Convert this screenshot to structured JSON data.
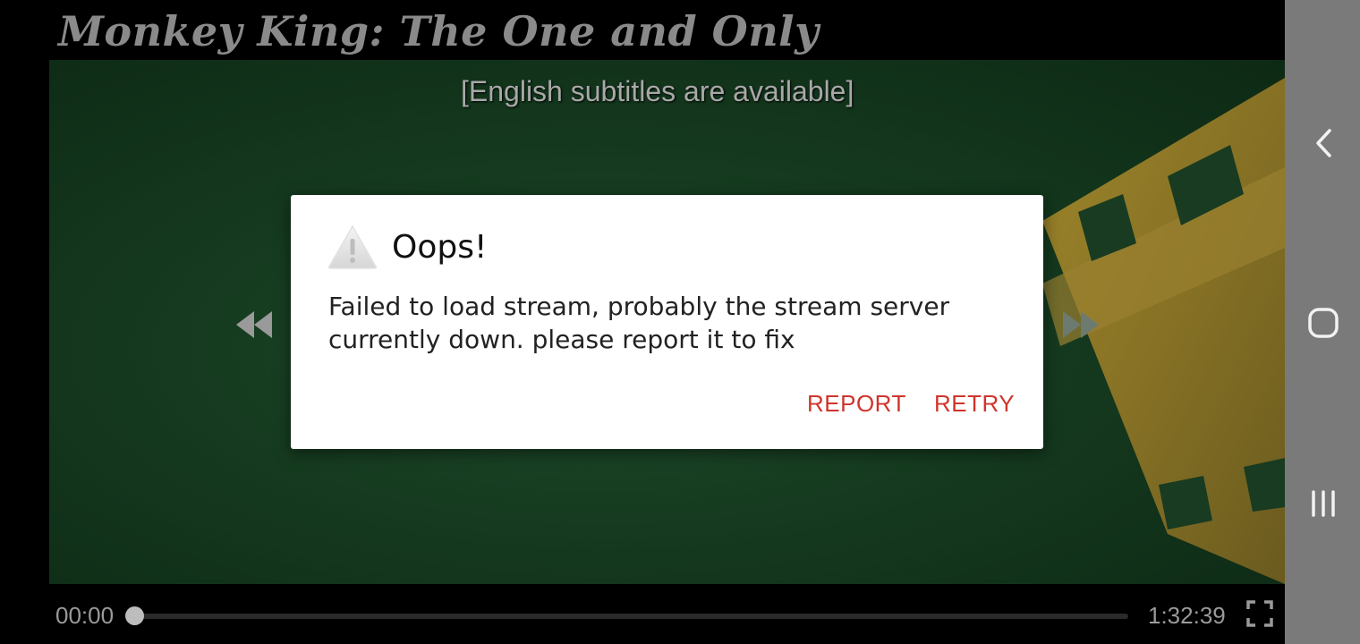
{
  "player": {
    "title": "Monkey King: The One and Only",
    "subtitle_notice": "[English subtitles are available]",
    "current_time": "00:00",
    "total_time": "1:32:39",
    "progress": 0.0
  },
  "dialog": {
    "title": "Oops!",
    "message": "Failed to load stream, probably the stream server currently down. please report it to fix",
    "report_label": "REPORT",
    "retry_label": "RETRY"
  },
  "icons": {
    "dialog": "warning-icon",
    "rewind": "rewind-icon",
    "fast_forward": "fast-forward-icon",
    "fullscreen": "fullscreen-icon",
    "nav_back": "back-icon",
    "nav_home": "home-icon",
    "nav_recents": "recents-icon"
  },
  "colors": {
    "accent": "#d0342c",
    "navbar": "#7a7a7a",
    "video_bg": "#153a1f"
  }
}
